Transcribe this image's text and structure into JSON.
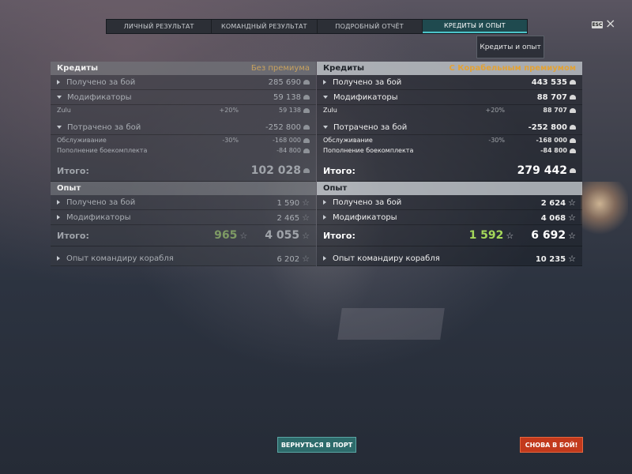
{
  "tabs": [
    "ЛИЧНЫЙ РЕЗУЛЬТАТ",
    "КОМАНДНЫЙ РЕЗУЛЬТАТ",
    "ПОДРОБНЫЙ ОТЧЁТ",
    "КРЕДИТЫ И ОПЫТ"
  ],
  "active_tab_index": 3,
  "esc_label": "ESC",
  "tooltip": "Кредиты и опыт",
  "left": {
    "credits_header": "Кредиты",
    "premium_label": "Без премиума",
    "earned_label": "Получено за бой",
    "earned_value": "285 690",
    "modifiers_label": "Модификаторы",
    "modifiers_value": "59 138",
    "zulu_label": "Zulu",
    "zulu_pct": "+20%",
    "zulu_value": "59 138",
    "spent_label": "Потрачено за бой",
    "spent_value": "-252 800",
    "service_label": "Обслуживание",
    "service_pct": "-30%",
    "service_value": "-168 000",
    "ammo_label": "Пополнение боекомплекта",
    "ammo_value": "-84 800",
    "total_label": "Итого:",
    "total_value": "102 028",
    "xp_header": "Опыт",
    "xp_earned_label": "Получено за бой",
    "xp_earned_value": "1 590",
    "xp_mod_label": "Модификаторы",
    "xp_mod_value": "2 465",
    "xp_total_label": "Итого:",
    "xp_free": "965",
    "xp_total": "4 055",
    "cmdr_label": "Опыт командиру корабля",
    "cmdr_value": "6 202"
  },
  "right": {
    "credits_header": "Кредиты",
    "premium_label": "С Корабельным премиумом",
    "earned_label": "Получено за бой",
    "earned_value": "443 535",
    "modifiers_label": "Модификаторы",
    "modifiers_value": "88 707",
    "zulu_label": "Zulu",
    "zulu_pct": "+20%",
    "zulu_value": "88 707",
    "spent_label": "Потрачено за бой",
    "spent_value": "-252 800",
    "service_label": "Обслуживание",
    "service_pct": "-30%",
    "service_value": "-168 000",
    "ammo_label": "Пополнение боекомплекта",
    "ammo_value": "-84 800",
    "total_label": "Итого:",
    "total_value": "279 442",
    "xp_header": "Опыт",
    "xp_earned_label": "Получено за бой",
    "xp_earned_value": "2 624",
    "xp_mod_label": "Модификаторы",
    "xp_mod_value": "4 068",
    "xp_total_label": "Итого:",
    "xp_free": "1 592",
    "xp_total": "6 692",
    "cmdr_label": "Опыт командиру корабля",
    "cmdr_value": "10 235"
  },
  "buttons": {
    "port": "ВЕРНУТЬСЯ В ПОРТ",
    "battle": "СНОВА В БОЙ!"
  },
  "colors": {
    "accent": "#4cc4c9",
    "premium": "#e2a235",
    "xp_green": "#a5d85a",
    "battle_button": "#c2391c",
    "port_button": "#2e6b6b"
  }
}
